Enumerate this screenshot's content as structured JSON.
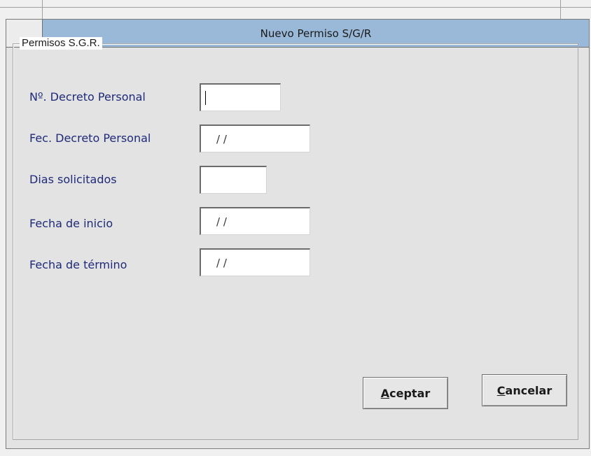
{
  "window": {
    "title": "Nuevo Permiso S/G/R"
  },
  "group": {
    "legend": "Permisos  S.G.R."
  },
  "fields": [
    {
      "label": "Nº. Decreto Personal",
      "value": ""
    },
    {
      "label": "Fec. Decreto Personal",
      "value": " /  /"
    },
    {
      "label": "Dias solicitados",
      "value": ""
    },
    {
      "label": "Fecha de inicio",
      "value": " /  /"
    },
    {
      "label": "Fecha de término",
      "value": " /  /"
    }
  ],
  "buttons": {
    "accept": {
      "accel": "A",
      "rest": "ceptar"
    },
    "cancel": {
      "accel": "C",
      "rest": "ancelar"
    }
  }
}
